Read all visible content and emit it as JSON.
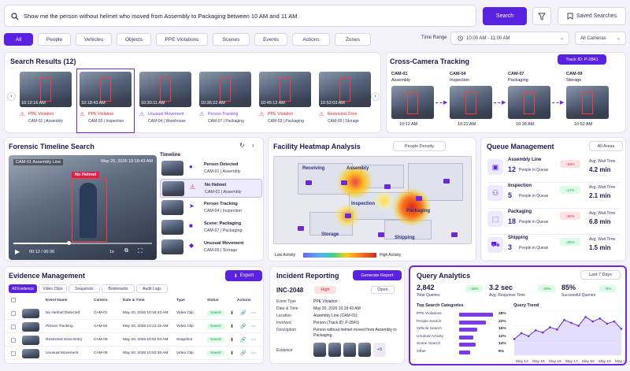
{
  "search": {
    "query": "Show me the person without helmet who moved from Assembly to Packaging between 10 AM and 11 AM",
    "button": "Search",
    "saved": "Saved Searches"
  },
  "filters": {
    "tabs": [
      "All",
      "People",
      "Vehicles",
      "Objects",
      "PPE Violations",
      "Scenes",
      "Events",
      "Actions",
      "Zones"
    ],
    "time_range_label": "Time Range",
    "time_range": "10:00 AM - 11:00 AM",
    "cameras": "All Cameras"
  },
  "results": {
    "title": "Search Results (12)",
    "items": [
      {
        "time": "10:12:16 AM",
        "event": "PPE Violation",
        "cam": "CAM-01 | Assembly",
        "color": "#dc2626"
      },
      {
        "time": "10:18:43 AM",
        "event": "PPE Violation",
        "cam": "CAM-03 | Inspection",
        "color": "#dc2626"
      },
      {
        "time": "10:30:11 AM",
        "event": "Unusual Movement",
        "cam": "CAM-04 | Warehouse",
        "color": "#7c3aed"
      },
      {
        "time": "10:36:22 AM",
        "event": "Person Tracking",
        "cam": "CAM-07 | Packaging",
        "color": "#7c3aed"
      },
      {
        "time": "10:45:12 AM",
        "event": "PPE Violation",
        "cam": "CAM-03 | Packaging",
        "color": "#dc2626"
      },
      {
        "time": "10:52:03 AM",
        "event": "Restricted Zone",
        "cam": "CAM-09 | Storage",
        "color": "#dc2626"
      }
    ]
  },
  "tracking": {
    "title": "Cross-Camera Tracking",
    "track_id": "Track ID: P-2841",
    "cams": [
      {
        "cam": "CAM-01",
        "zone": "Assembly",
        "time": "10:12 AM"
      },
      {
        "cam": "CAM-04",
        "zone": "Inspection",
        "time": "10:22 AM"
      },
      {
        "cam": "CAM-07",
        "zone": "Packaging",
        "time": "10:38 AM"
      },
      {
        "cam": "CAM-09",
        "zone": "Storage",
        "time": "10:52 AM"
      }
    ]
  },
  "forensic": {
    "title": "Forensic Timeline Search",
    "date": "May 20, 2026  10:18:43 AM",
    "cam": "CAM-01",
    "zone": "Assembly Line",
    "alert": "No Helmet",
    "time": "00:12 / 00:30",
    "speed": "1x",
    "timeline_label": "Timeline",
    "timeline": [
      {
        "title": "Person Detected",
        "sub": "CAM-01 | Assembly"
      },
      {
        "title": "No Helmet",
        "sub": "CAM-01 | Assembly"
      },
      {
        "title": "Person Tracking",
        "sub": "CAM-04 | Inspection"
      },
      {
        "title": "Scene: Packaging",
        "sub": "CAM-07 | Packaging"
      },
      {
        "title": "Unusual Movement",
        "sub": "CAM-09 | Storage"
      }
    ]
  },
  "heatmap": {
    "title": "Facility Heatmap Analysis",
    "metric": "People Density",
    "zones": [
      "Receiving",
      "Assembly",
      "Inspection",
      "Packaging",
      "Storage",
      "Shipping"
    ],
    "low": "Low Activity",
    "high": "High Activity"
  },
  "queue": {
    "title": "Queue Management",
    "filter": "All Areas",
    "people_label": "People in Queue",
    "wait_label": "Avg. Wait Time",
    "areas": [
      {
        "name": "Assembly Line",
        "count": "12",
        "delta": "33%",
        "up": true,
        "wait": "4.2 min"
      },
      {
        "name": "Inspection",
        "count": "5",
        "delta": "17%",
        "up": false,
        "wait": "2.1 min"
      },
      {
        "name": "Packaging",
        "count": "18",
        "delta": "50%",
        "up": true,
        "wait": "6.8 min"
      },
      {
        "name": "Shipping",
        "count": "3",
        "delta": "25%",
        "up": false,
        "wait": "1.5 min"
      }
    ]
  },
  "evidence": {
    "title": "Evidence Management",
    "export": "Export",
    "tabs": [
      "All Evidence",
      "Video Clips",
      "Snapshots",
      "Bookmarks",
      "Audit Logs"
    ],
    "headers": [
      "Event Name",
      "Camera",
      "Date & Time",
      "Type",
      "Status",
      "Actions"
    ],
    "rows": [
      {
        "name": "No Helmet Detected",
        "cam": "CAM-01",
        "dt": "May 20, 2026 10:18:43 AM",
        "type": "Video Clip",
        "status": "Saved"
      },
      {
        "name": "Person Tracking",
        "cam": "CAM-04",
        "dt": "May 20, 2026 10:22:15 AM",
        "type": "Video Clip",
        "status": "Saved"
      },
      {
        "name": "Restricted Zone Entry",
        "cam": "CAM-09",
        "dt": "May 20, 2026 10:52:03 AM",
        "type": "Snapshot",
        "status": "Saved"
      },
      {
        "name": "Unusual Movement",
        "cam": "CAM-09",
        "dt": "May 20, 2026 10:52:36 AM",
        "type": "Video Clip",
        "status": "Saved"
      }
    ]
  },
  "incident": {
    "title": "Incident Reporting",
    "generate": "Generate Report",
    "id": "INC-2048",
    "severity": "High",
    "state": "Open",
    "fields": [
      {
        "k": "Event Type",
        "v": "PPE Violation"
      },
      {
        "k": "Date & Time",
        "v": "May 20, 2026 10:18:43 AM"
      },
      {
        "k": "Location",
        "v": "Assembly Line (CAM-01)"
      },
      {
        "k": "Involved",
        "v": "Person (Track ID: P-2841)"
      },
      {
        "k": "Description",
        "v": "Person without helmet moved from Assembly to Packaging."
      }
    ],
    "evidence_label": "Evidence",
    "more": "+5"
  },
  "analytics": {
    "title": "Query Analytics",
    "range": "Last 7 Days",
    "kpis": [
      {
        "value": "2,842",
        "label": "Total Queries",
        "delta": "18%"
      },
      {
        "value": "3.2 sec",
        "label": "Avg. Response Time",
        "delta": "25%"
      },
      {
        "value": "85%",
        "label": "Successful Queries",
        "delta": "6%"
      }
    ],
    "cat_title": "Top Search Categories",
    "trend_title": "Query Trend"
  },
  "chart_data": [
    {
      "type": "bar",
      "title": "Top Search Categories",
      "categories": [
        "PPE Violations",
        "People Search",
        "Vehicle Search",
        "Unusual Activity",
        "Scene Search",
        "Other"
      ],
      "values": [
        28,
        22,
        15,
        12,
        14,
        9
      ],
      "unit": "%"
    },
    {
      "type": "area",
      "title": "Query Trend",
      "x": [
        "May 14",
        "May 15",
        "May 16",
        "May 17",
        "May 18",
        "May 19",
        "May 20"
      ],
      "values": [
        22,
        30,
        26,
        34,
        31,
        38,
        35,
        48,
        44,
        40,
        52,
        46,
        50,
        43,
        46,
        36
      ],
      "tick_labels": [
        "May 14",
        "May 15",
        "May 16",
        "May 17",
        "May 18",
        "May 19",
        "May 20"
      ]
    }
  ],
  "colors": {
    "accent": "#5b21e0",
    "danger": "#dc2626",
    "success": "#16a34a"
  }
}
